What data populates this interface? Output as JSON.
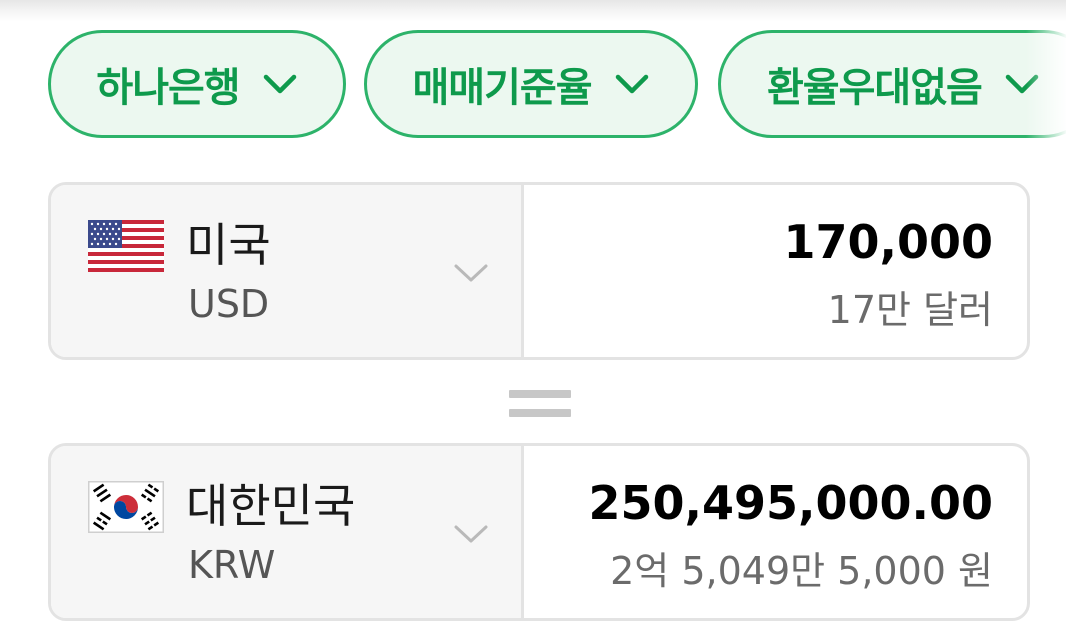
{
  "filters": [
    {
      "label": "하나은행"
    },
    {
      "label": "매매기준율"
    },
    {
      "label": "환율우대없음"
    }
  ],
  "from": {
    "country": "미국",
    "code": "USD",
    "amount": "170,000",
    "amount_words": "17만 달러",
    "flag_icon": "us-flag-icon"
  },
  "to": {
    "country": "대한민국",
    "code": "KRW",
    "amount": "250,495,000.00",
    "amount_words": "2억 5,049만 5,000 원",
    "flag_icon": "kr-flag-icon"
  },
  "colors": {
    "accent": "#0e9a4c",
    "chip_border": "#2db36a",
    "chip_bg": "#ecf8f0"
  }
}
